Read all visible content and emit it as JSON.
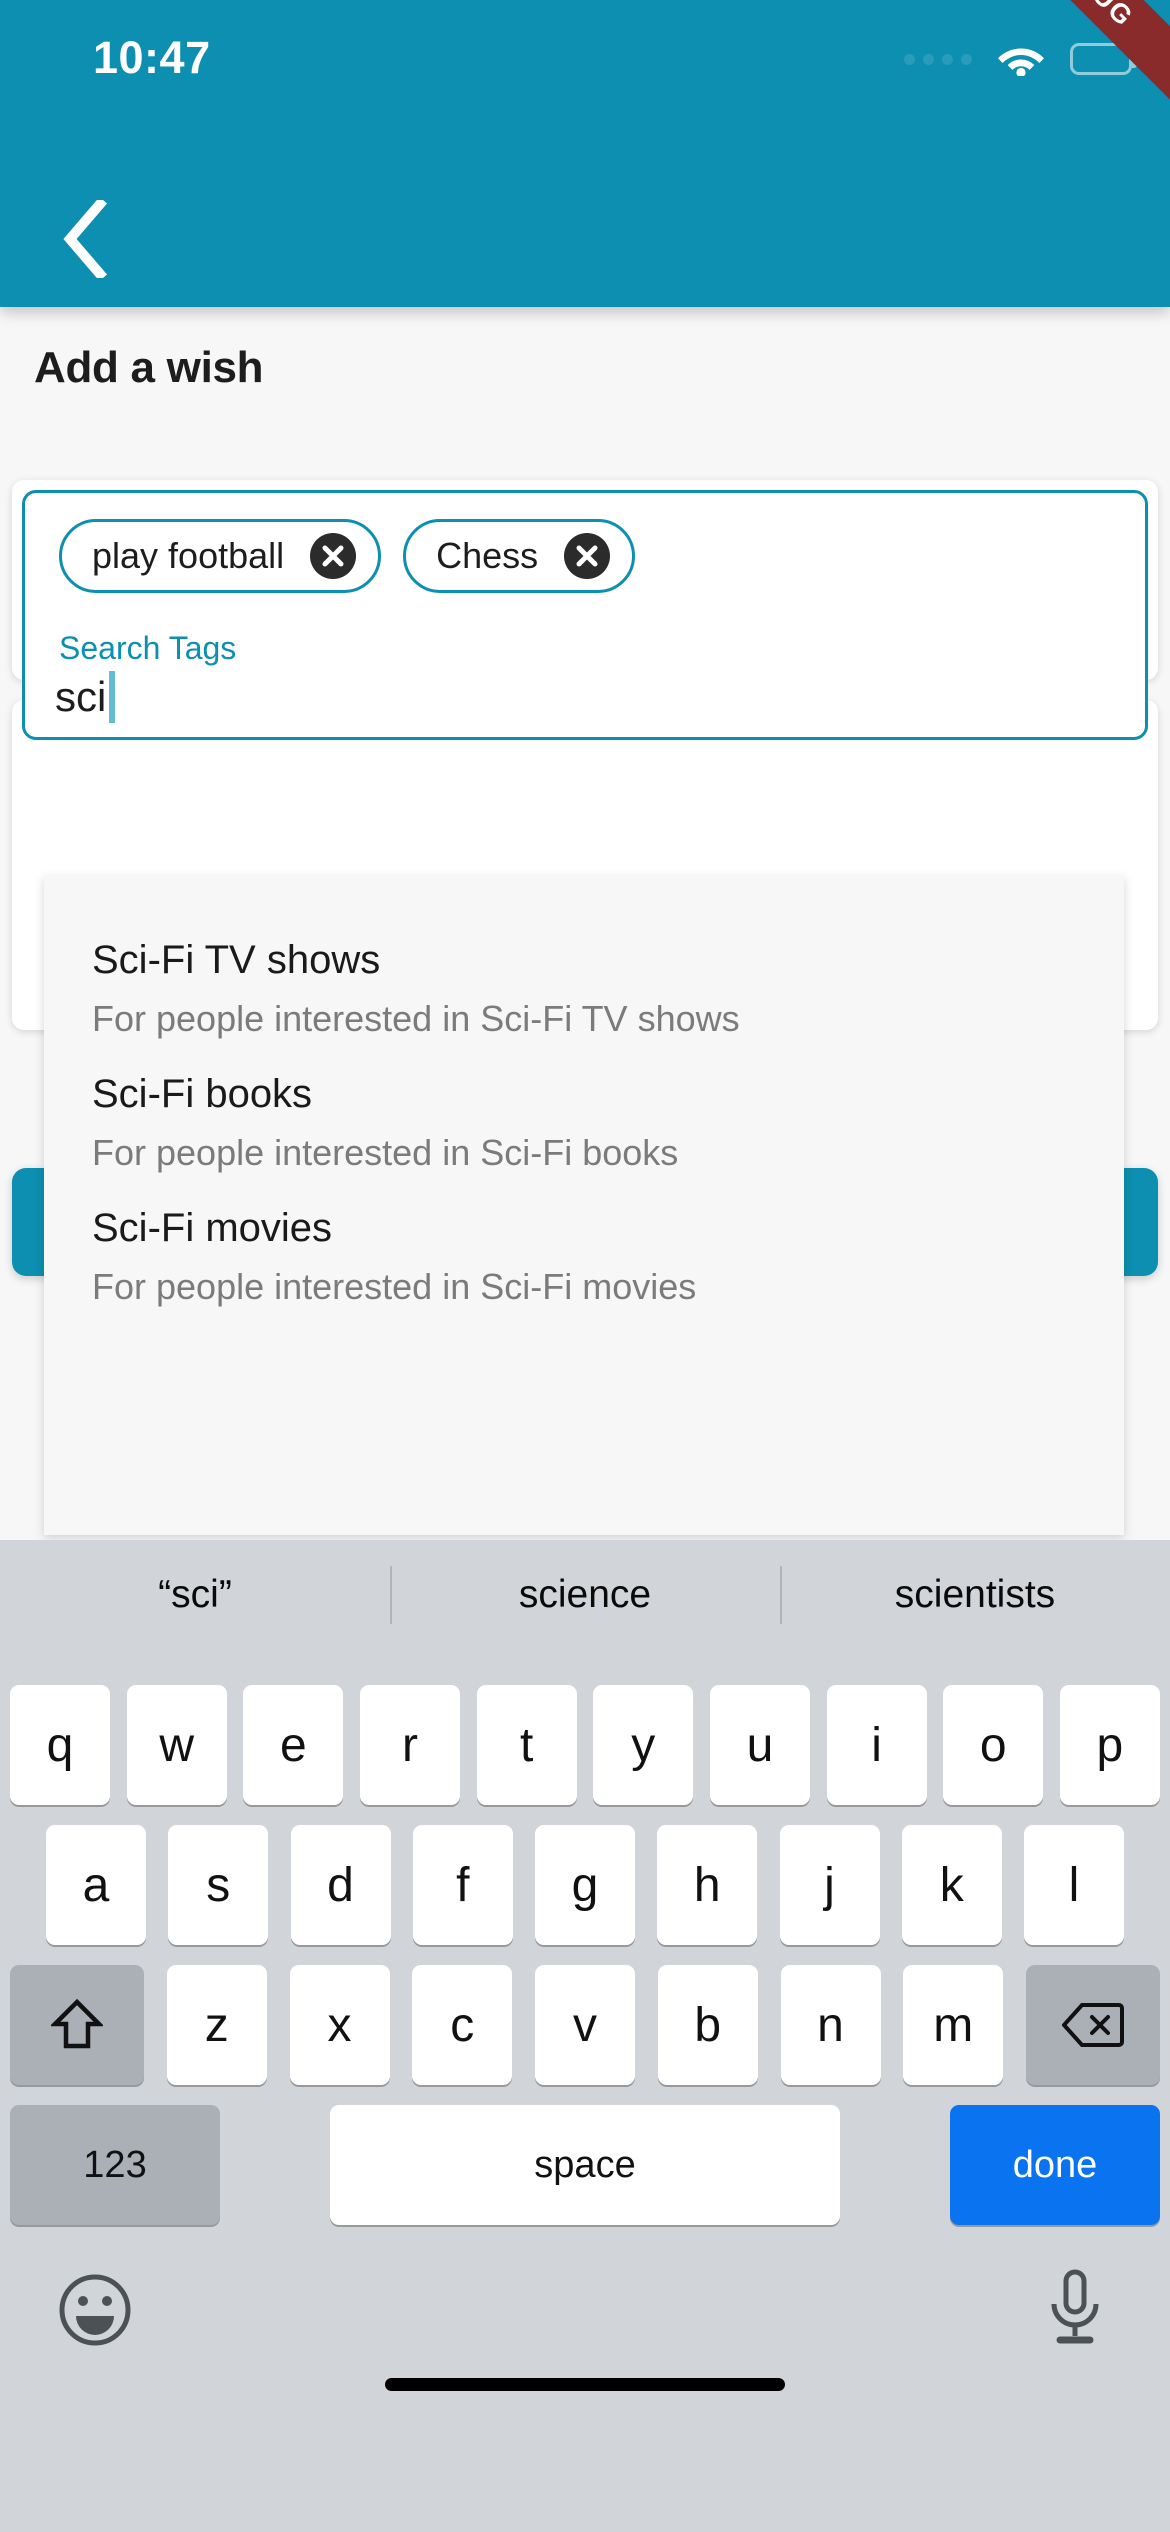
{
  "status_bar": {
    "time": "10:47",
    "signal_icon": "signal-dots-icon",
    "wifi_icon": "wifi-icon",
    "battery_icon": "battery-icon"
  },
  "debug_ribbon": {
    "label": "DEBUG"
  },
  "app_bar": {
    "back_icon": "chevron-left-icon",
    "background_color": "#0c8fb0"
  },
  "page": {
    "title": "Add a wish"
  },
  "tag_input": {
    "label": "Search Tags",
    "value": "sci",
    "placeholder": "Search Tags",
    "border_color": "#0c8fb0",
    "chips": [
      {
        "label": "play football",
        "remove_icon": "close-circle-icon"
      },
      {
        "label": "Chess",
        "remove_icon": "close-circle-icon"
      }
    ]
  },
  "submit_button": {
    "label": "",
    "color": "#0c8fb0"
  },
  "suggestions": [
    {
      "title": "Sci-Fi TV shows",
      "subtitle": "For people interested in Sci-Fi TV shows"
    },
    {
      "title": "Sci-Fi books",
      "subtitle": "For people interested in Sci-Fi books"
    },
    {
      "title": "Sci-Fi movies",
      "subtitle": "For people interested in Sci-Fi movies"
    }
  ],
  "keyboard": {
    "predictions": [
      "“sci”",
      "science",
      "scientists"
    ],
    "row1": [
      "q",
      "w",
      "e",
      "r",
      "t",
      "y",
      "u",
      "i",
      "o",
      "p"
    ],
    "row2": [
      "a",
      "s",
      "d",
      "f",
      "g",
      "h",
      "j",
      "k",
      "l"
    ],
    "row3_letters": [
      "z",
      "x",
      "c",
      "v",
      "b",
      "n",
      "m"
    ],
    "shift_icon": "shift-arrow-icon",
    "backspace_icon": "backspace-icon",
    "numbers_key": "123",
    "space_key": "space",
    "done_key": "done",
    "emoji_icon": "emoji-smiley-icon",
    "mic_icon": "microphone-icon",
    "done_color": "#0a74f0"
  }
}
